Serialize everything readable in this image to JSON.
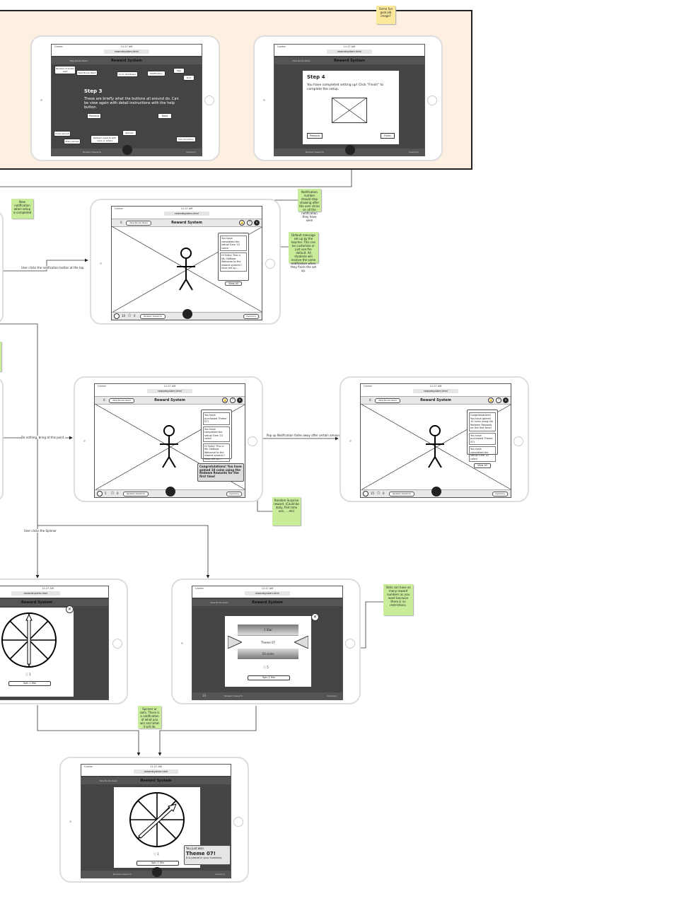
{
  "common": {
    "carrier": "Carrier",
    "time": "11:27 AM",
    "url": "rewardsystem.html",
    "app_title": "Reward System",
    "new_books_read": "New Books Read",
    "redeem_rewards": "Redeem Rewards",
    "inventory": "Inventory",
    "help_icon": "?",
    "close_icon": "✕",
    "count_zero": "0",
    "coins_10": "10",
    "coins_15": "15",
    "coins_5": "5"
  },
  "step3": {
    "title": "Step 3",
    "body": "These are briefly what the buttons all around do. Can be view again with detail instructions with the help button.",
    "prev": "Previous",
    "next": "Next",
    "callouts": [
      "Number of books read",
      "New Books Read",
      "Go to dashboard",
      "Notification",
      "Help",
      "Exit",
      "Coins earned",
      "Stars earned",
      "Redeem rewards with coins or others",
      "Spinner",
      "Your Inventory"
    ]
  },
  "step4": {
    "title": "Step 4",
    "body": "You have completed setting up! Click \"Finish\" to complete the setup.",
    "prev": "Previous",
    "finish": "Finish"
  },
  "screen_notif1": {
    "items": [
      "You have completed the setup! Earn 10 coins!",
      "Hi Folks! This is Ms. DeRose. Welcome to the reward system! I have set up..."
    ],
    "view_all": "View All"
  },
  "screen_notif2": {
    "items": [
      "You have purchased Theme 07!",
      "You have completed the setup! Earn 10 coins!",
      "Hi Folks! This is Ms. DeRose. Welcome to the reward system! I have set up..."
    ],
    "view_all": "View All",
    "congrats": "Congratulations! You have gained 10 coins using the Redeem Rewards for the first time!"
  },
  "screen_notif3": {
    "items": [
      "Congratulations! You have gained 10 coins using the Redeem Rewards for the first time!",
      "You have purchased Theme 07!",
      "You have completed the setup! Earn 10 coins!"
    ],
    "view_all": "View All"
  },
  "slots": {
    "top": "1 Star",
    "middle": "Theme 07",
    "bottom": "10 coins",
    "spin": "Spin 1 Min",
    "cost": "5"
  },
  "spinner": {
    "spin": "Spin 1 Min",
    "cost": "1"
  },
  "result": {
    "prefix": "You just won",
    "prize": "Theme 07!",
    "suffix": "It is placed in your Inventory.",
    "spin": "Spin 1 Min",
    "cost": "1"
  },
  "notes": {
    "fun_goal": "Some fun goal job image?",
    "new_notification": "New notification when setup is completed",
    "notif_stop": "Notification number should stop showing after the user clicks on all the notification they have seen",
    "default_message": "Default message set up by the teacher. This can be customize or just use the default. All students will receive the same notification when they finish the set up.",
    "random_surprise": "Random Surprise reward. (Could be daily, first time use, ....etc)",
    "slots_rewards": "Slots can have as many reward numbers as you want because there is no restrictions.",
    "spinner_or_slots": "Spinner or slots. There is a notification of what you win and what it will do."
  },
  "edges": {
    "clicks_notification": "User clicks the notification button at the top",
    "do_nothing": "Do nothing, bring at this point.",
    "popup_fades": "Pop up Notification fades away after certain amount of time",
    "clicks_spinner": "User clicks the Spinner"
  }
}
